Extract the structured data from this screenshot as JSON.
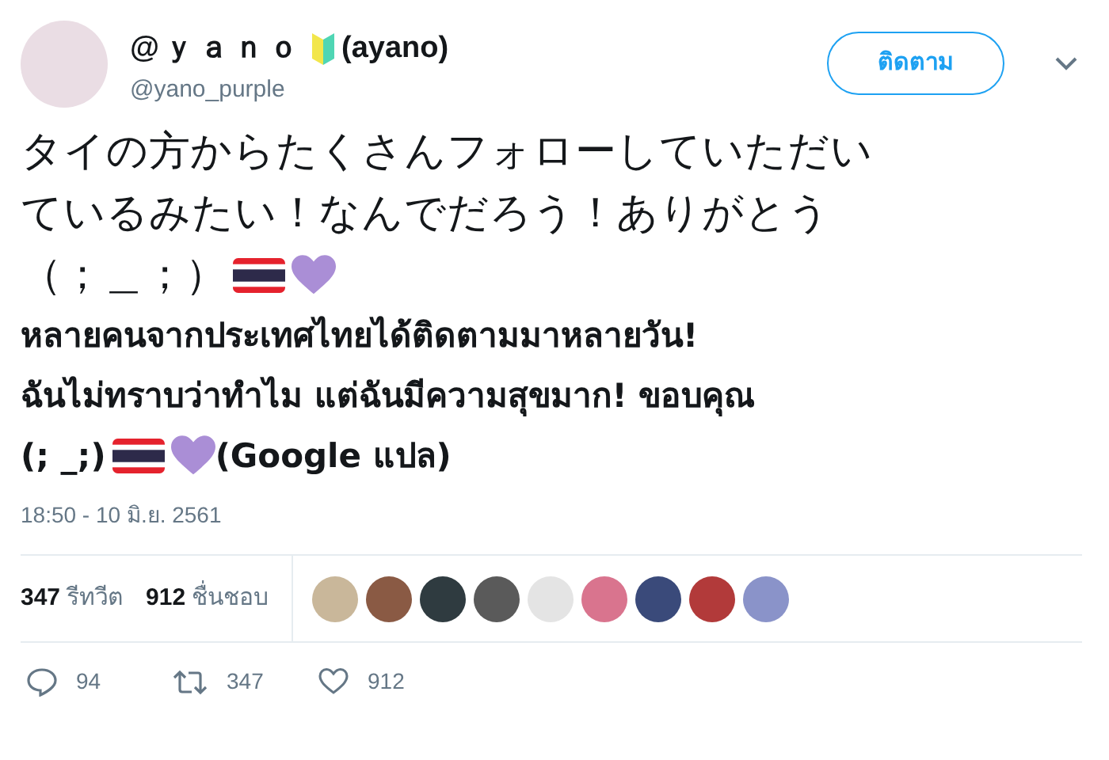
{
  "author": {
    "display_name": "@ｙａｎｏ",
    "name_suffix": "(ayano)",
    "handle": "@yano_purple"
  },
  "follow_button": "ติดตาม",
  "tweet_lines": [
    [
      {
        "kind": "text",
        "text": "タイの方からたくさんフォローしていただい"
      }
    ],
    [
      {
        "kind": "text",
        "text": "ているみたい！なんでだろう！ありがとう"
      }
    ],
    [
      {
        "kind": "text",
        "text": "（；＿；）"
      },
      {
        "kind": "flag"
      },
      {
        "kind": "heart"
      }
    ]
  ],
  "translation_lines": [
    [
      {
        "kind": "text",
        "text": "หลายคนจากประเทศไทยได้ติดตามมาหลายวัน!"
      }
    ],
    [
      {
        "kind": "text",
        "text": "ฉันไม่ทราบว่าทำไม แต่ฉันมีความสุขมาก! ขอบคุณ"
      }
    ],
    [
      {
        "kind": "text",
        "text": "(; _;)"
      },
      {
        "kind": "flag"
      },
      {
        "kind": "heart"
      },
      {
        "kind": "text",
        "text": "(Google แปล)"
      }
    ]
  ],
  "timestamp": "18:50 - 10 มิ.ย. 2561",
  "stats": [
    {
      "count": "347",
      "label": "รีทวีต"
    },
    {
      "count": "912",
      "label": "ชื่นชอบ"
    }
  ],
  "actions": [
    {
      "kind": "reply",
      "count": "94"
    },
    {
      "kind": "retweet",
      "count": "347"
    },
    {
      "kind": "like",
      "count": "912"
    }
  ]
}
